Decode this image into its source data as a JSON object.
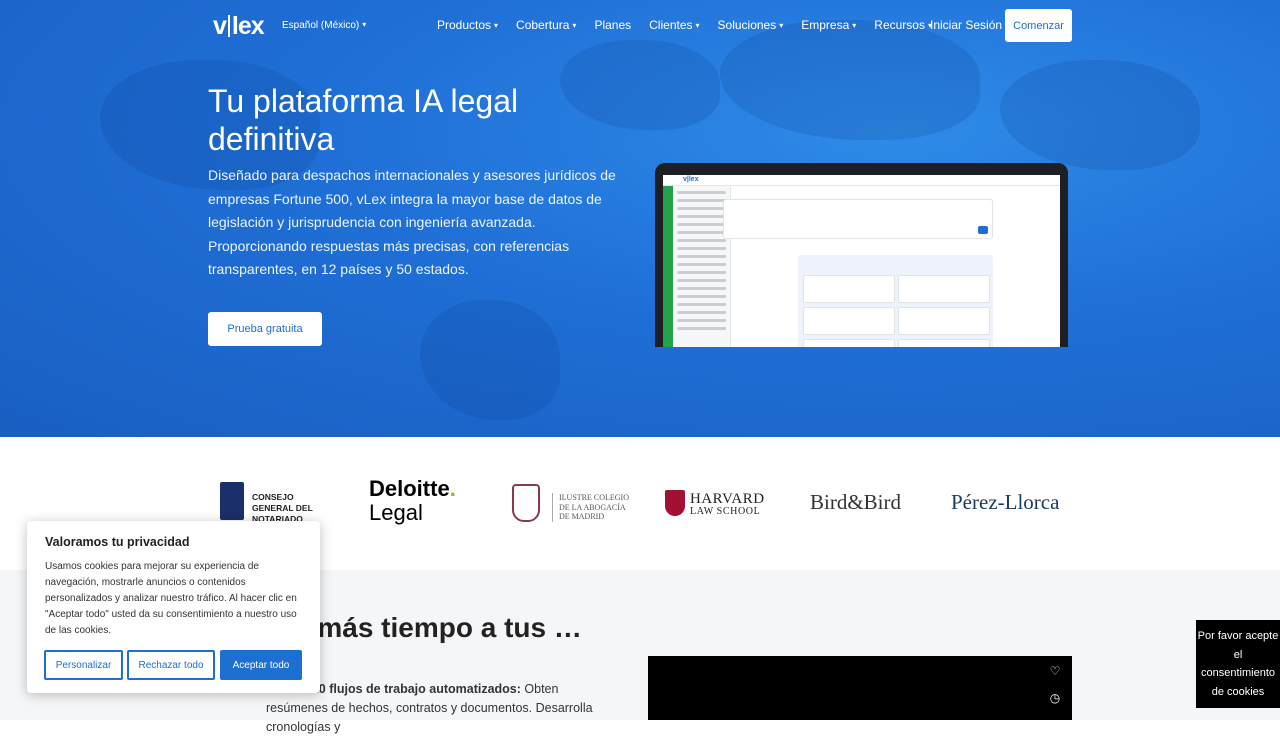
{
  "nav": {
    "logo": "v|lex",
    "language": "Español (México)",
    "items": [
      "Productos",
      "Cobertura",
      "Planes",
      "Clientes",
      "Soluciones",
      "Empresa",
      "Recursos"
    ],
    "login": "Iniciar Sesión",
    "start": "Comenzar"
  },
  "hero": {
    "title": "Tu plataforma IA legal definitiva",
    "description": "Diseñado para despachos internacionales y asesores jurídicos de empresas Fortune 500, vLex integra la mayor base de datos de legislación y jurisprudencia con ingeniería avanzada. Proporcionando respuestas más precisas, con referencias transparentes, en 12 países y 50 estados.",
    "cta": "Prueba gratuita"
  },
  "logos": {
    "notariado": "CONSEJO GENERAL DEL NOTARIADO",
    "deloitte_main": "Deloitte",
    "deloitte_sub": "Legal",
    "icam": "ILUSTRE COLEGIO DE LA ABOGACÍA DE MADRID",
    "harvard_1": "HARVARD",
    "harvard_2": "LAW SCHOOL",
    "bird": "Bird&Bird",
    "perez": "Pérez-Llorca"
  },
  "lower": {
    "title": "…a más tiempo a tus …es",
    "desc_bold": "Más de 20 flujos de trabajo automatizados:",
    "desc_rest": " Obten resúmenes de hechos, contratos y documentos. Desarrolla cronologías y"
  },
  "cookie": {
    "title": "Valoramos tu privacidad",
    "text": "Usamos cookies para mejorar su experiencia de navegación, mostrarle anuncios o contenidos personalizados y analizar nuestro tráfico. Al hacer clic en \"Aceptar todo\" usted da su consentimiento a nuestro uso de las cookies.",
    "customize": "Personalizar",
    "reject": "Rechazar todo",
    "accept": "Aceptar todo"
  },
  "consent_side": "Por favor acepte el consentimiento de cookies",
  "colors": {
    "brand": "#1d6fd1",
    "hero_bg": "#1f6fd6"
  }
}
